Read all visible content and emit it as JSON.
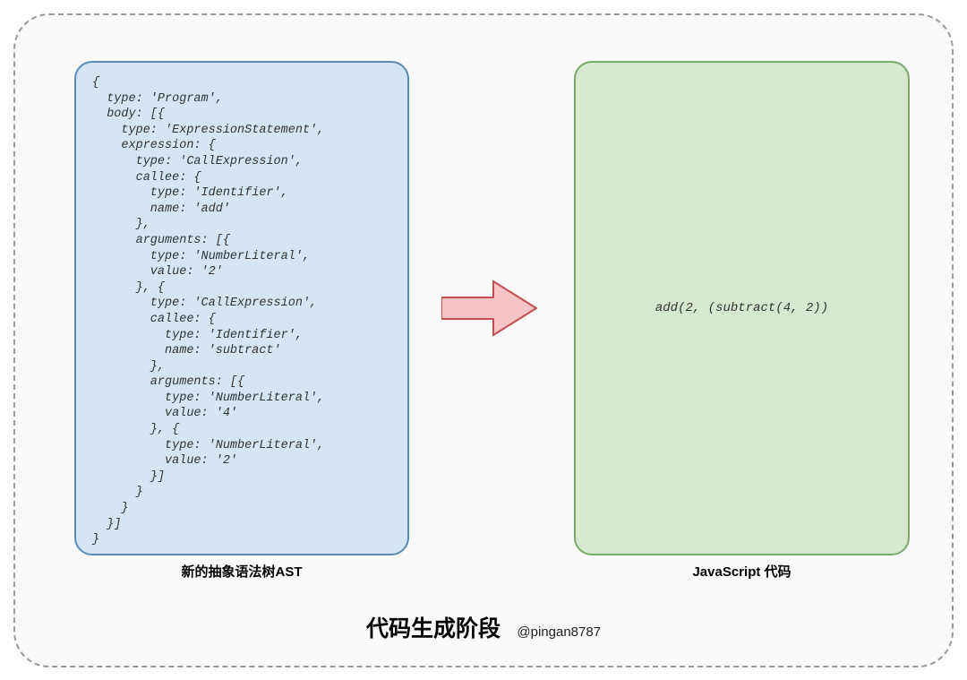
{
  "left": {
    "label": "新的抽象语法树AST",
    "code": "{\n  type: 'Program',\n  body: [{\n    type: 'ExpressionStatement',\n    expression: {\n      type: 'CallExpression',\n      callee: {\n        type: 'Identifier',\n        name: 'add'\n      },\n      arguments: [{\n        type: 'NumberLiteral',\n        value: '2'\n      }, {\n        type: 'CallExpression',\n        callee: {\n          type: 'Identifier',\n          name: 'subtract'\n        },\n        arguments: [{\n          type: 'NumberLiteral',\n          value: '4'\n        }, {\n          type: 'NumberLiteral',\n          value: '2'\n        }]\n      }\n    }\n  }]\n}"
  },
  "right": {
    "label": "JavaScript 代码",
    "code": "add(2, (subtract(4, 2))"
  },
  "title": {
    "main": "代码生成阶段",
    "sub": "@pingan8787"
  }
}
